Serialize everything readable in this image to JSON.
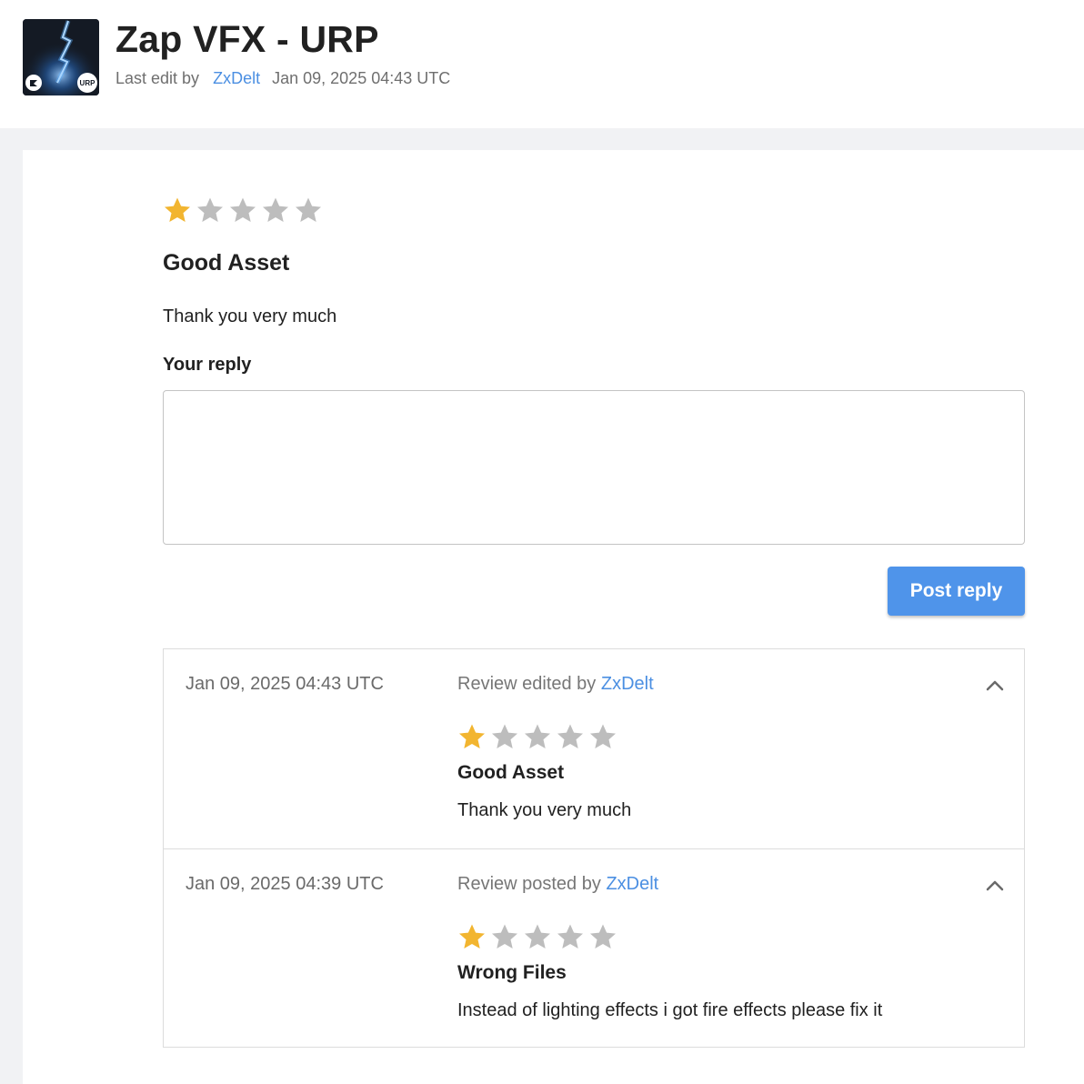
{
  "header": {
    "title": "Zap VFX - URP",
    "last_edit_label": "Last edit by",
    "last_edit_user": "ZxDelt",
    "last_edit_date": "Jan 09, 2025 04:43 UTC",
    "thumbnail_badge": "URP"
  },
  "review": {
    "rating": 1,
    "max_rating": 5,
    "title": "Good Asset",
    "body": "Thank you very much",
    "reply_label": "Your reply",
    "reply_value": "",
    "post_button": "Post reply"
  },
  "history": [
    {
      "date": "Jan 09, 2025 04:43 UTC",
      "action": "Review edited by",
      "user": "ZxDelt",
      "rating": 1,
      "title": "Good Asset",
      "body": "Thank you very much"
    },
    {
      "date": "Jan 09, 2025 04:39 UTC",
      "action": "Review posted by",
      "user": "ZxDelt",
      "rating": 1,
      "title": "Wrong Files",
      "body": "Instead of lighting effects i got fire effects please fix it"
    }
  ],
  "colors": {
    "star_filled": "#f2b530",
    "star_empty": "#bdbdbd",
    "link": "#4b8fe2",
    "button": "#4f94ea"
  },
  "icons": {
    "collapse": "chevron-up-icon",
    "star": "star-icon"
  }
}
